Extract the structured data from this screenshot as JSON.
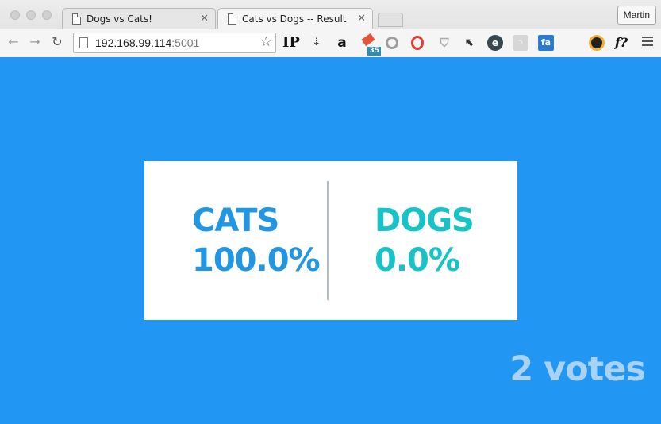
{
  "browser": {
    "tabs": [
      {
        "title": "Dogs vs Cats!",
        "active": false
      },
      {
        "title": "Cats vs Dogs -- Result",
        "active": true
      }
    ],
    "profile_name": "Martin",
    "url_host": "192.168.99.114",
    "url_port": ":5001",
    "extensions": [
      "ip-icon",
      "download-arrow-icon",
      "amazon-icon",
      "eraser-badge-icon",
      "ring-icon",
      "opera-icon",
      "shield-icon",
      "cursor-icon",
      "e-circle-icon",
      "rss-icon",
      "fa-icon",
      "camera-lens-icon",
      "f-question-icon"
    ],
    "extension_labels": {
      "ip": "IP",
      "amazon": "a",
      "badge": "35",
      "fa": "fa",
      "f_help": "f?"
    }
  },
  "result": {
    "options": [
      {
        "label": "CATS",
        "percent": "100.0%",
        "color": "#2196e3"
      },
      {
        "label": "DOGS",
        "percent": "0.0%",
        "color": "#17c3c7"
      }
    ],
    "votes_text": "2 votes"
  },
  "colors": {
    "page_background": "#2196f3",
    "votes_text": "#a9d2f7"
  }
}
